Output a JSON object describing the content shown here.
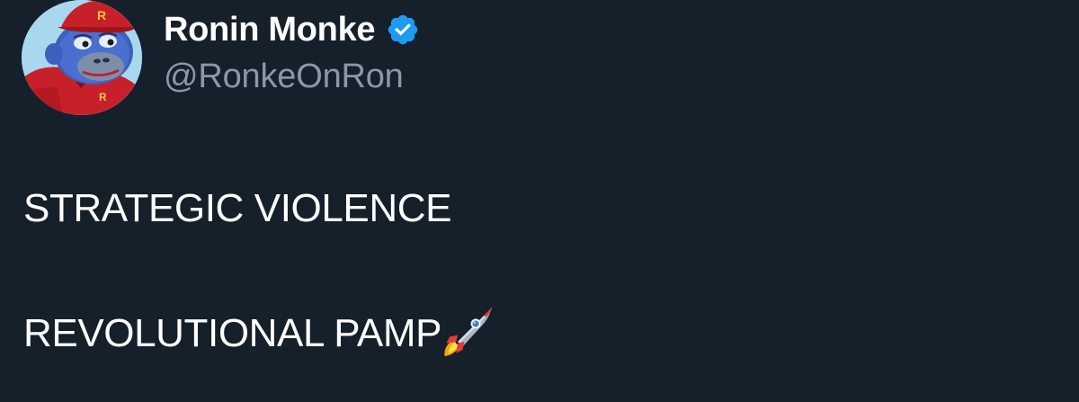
{
  "author": {
    "display_name": "Ronin Monke",
    "handle": "@RonkeOnRon",
    "verified": true,
    "verified_color": "#1d9bf0",
    "avatar_icon": "monkey-avatar-red-cap",
    "avatar_cap_letter": "R"
  },
  "tweet": {
    "lines": [
      "STRATEGIC VIOLENCE",
      "REVOLUTIONAL PAMP"
    ],
    "trailing_emoji_icon": "rocket-icon"
  },
  "colors": {
    "background": "#16202b",
    "primary_text": "#ffffff",
    "secondary_text": "#8b98a5"
  }
}
